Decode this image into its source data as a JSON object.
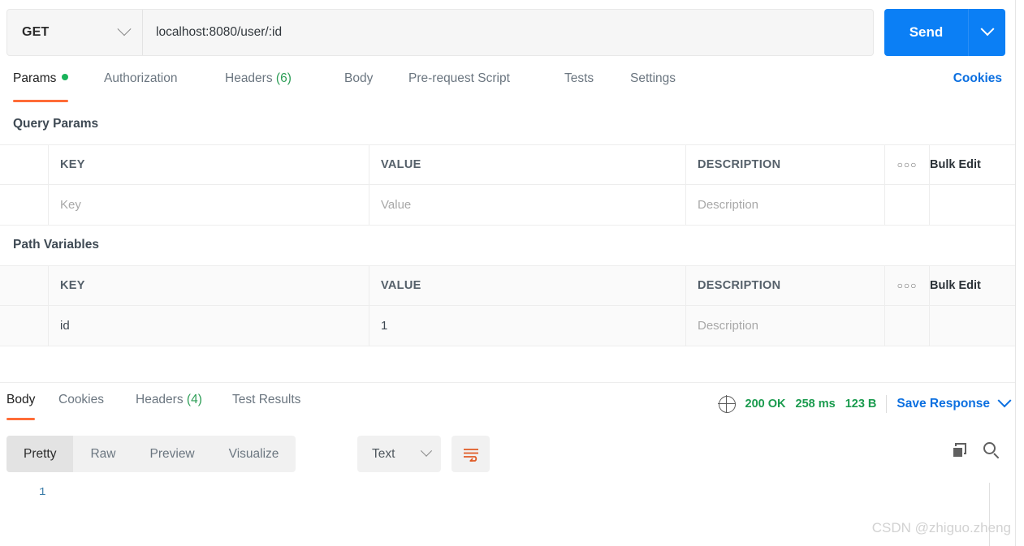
{
  "request": {
    "method": "GET",
    "url_value": "localhost:8080/user/:id",
    "url_placeholder": "Enter request URL",
    "send_label": "Send"
  },
  "request_tabs": [
    {
      "label": "Params",
      "has_dot": true,
      "active": true
    },
    {
      "label": "Authorization",
      "active": false
    },
    {
      "label": "Headers",
      "count": "(6)",
      "active": false
    },
    {
      "label": "Body",
      "active": false
    },
    {
      "label": "Pre-request Script",
      "active": false
    },
    {
      "label": "Tests",
      "active": false
    },
    {
      "label": "Settings",
      "active": false
    }
  ],
  "cookies_link": "Cookies",
  "query_params": {
    "title": "Query Params",
    "headers": {
      "key": "KEY",
      "value": "VALUE",
      "description": "DESCRIPTION",
      "dots": "○○○",
      "bulk": "Bulk Edit"
    },
    "rows": [
      {
        "key": "Key",
        "value": "Value",
        "description": "Description",
        "placeholder": true
      }
    ]
  },
  "path_variables": {
    "title": "Path Variables",
    "headers": {
      "key": "KEY",
      "value": "VALUE",
      "description": "DESCRIPTION",
      "dots": "○○○",
      "bulk": "Bulk Edit"
    },
    "rows": [
      {
        "key": "id",
        "value": "1",
        "description": "Description",
        "placeholder": false
      }
    ]
  },
  "response_tabs": [
    {
      "label": "Body",
      "active": true
    },
    {
      "label": "Cookies",
      "active": false
    },
    {
      "label": "Headers",
      "count": "(4)",
      "active": false
    },
    {
      "label": "Test Results",
      "active": false
    }
  ],
  "response_meta": {
    "status": "200 OK",
    "time": "258 ms",
    "size": "123 B",
    "save_label": "Save Response"
  },
  "viewer": {
    "modes": [
      {
        "label": "Pretty",
        "active": true
      },
      {
        "label": "Raw",
        "active": false
      },
      {
        "label": "Preview",
        "active": false
      },
      {
        "label": "Visualize",
        "active": false
      }
    ],
    "format": "Text",
    "line_numbers": [
      "1"
    ],
    "body_lines": [
      ""
    ]
  },
  "watermark": "CSDN @zhiguo.zheng",
  "colors": {
    "accent": "#ff6c37",
    "send_blue": "#0b7ff5",
    "link_blue": "#0b6fe0",
    "status_green": "#1a9b4e",
    "dot_green": "#19b35a"
  }
}
